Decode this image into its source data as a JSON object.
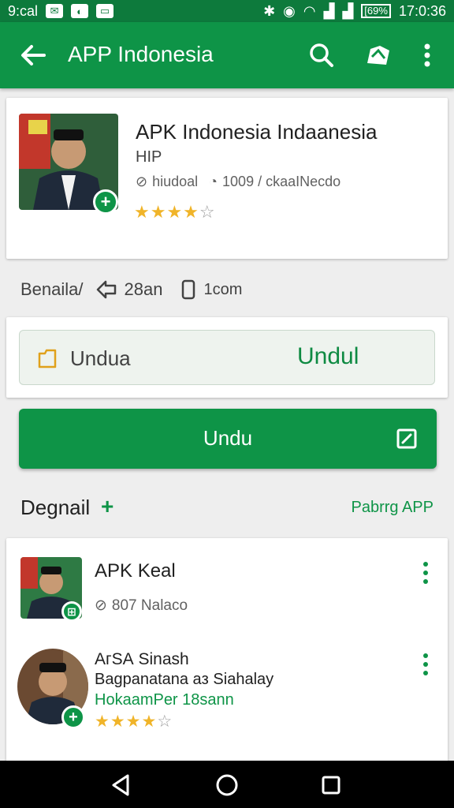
{
  "status": {
    "carrier": "9:cal",
    "time": "17:0:36",
    "battery_label": "[69%"
  },
  "appbar": {
    "title": "APP Indonesia"
  },
  "header_card": {
    "app_name": "APK Indonesia Indaanesia",
    "subtitle": "HIP",
    "meta_category": "hiudoal",
    "meta_downloads": "1009 / ckaaINecdo",
    "rating": 4
  },
  "info_row": {
    "label": "Benaila/",
    "size": "28an",
    "device": "1com"
  },
  "download_box": {
    "left_label": "Undua",
    "right_label": "Undul"
  },
  "primary_button": {
    "label": "Undu"
  },
  "section": {
    "title": "Degnail",
    "link": "Pabrrg APP"
  },
  "list": [
    {
      "title": "APK Keal",
      "line2": "807 Nalaco"
    },
    {
      "title": "AгЅА Sinash",
      "line2": "Bagpanatana aз Siahalay",
      "line3": "HokaamPer 18sann",
      "rating": 4
    }
  ],
  "colors": {
    "primary": "#0e9447",
    "primary_dark": "#0d7a3c",
    "star": "#f0b429"
  }
}
